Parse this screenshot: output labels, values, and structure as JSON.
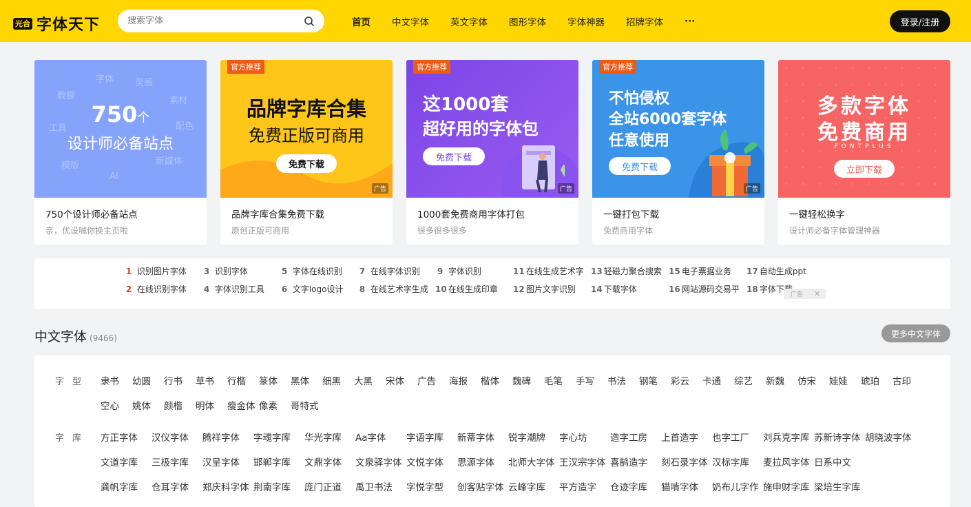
{
  "header": {
    "logo_badge": "光合",
    "logo_text": "字体天下",
    "search_placeholder": "搜索字体",
    "login": "登录/注册",
    "nav": [
      "首页",
      "中文字体",
      "英文字体",
      "图形字体",
      "字体神器",
      "招牌字体",
      "···"
    ]
  },
  "cards": [
    {
      "tag": "",
      "title": "750个设计师必备站点",
      "sub": "亲，优设喊你换主页啦",
      "banner": {
        "big": "750",
        "unit": "个",
        "mid": "设计师必备站点",
        "words": [
          "字体",
          "灵感",
          "教程",
          "素材",
          "工具",
          "配色",
          "模版",
          "新媒体",
          "AI"
        ]
      }
    },
    {
      "tag": "官方推荐",
      "title": "品牌字库合集免费下载",
      "sub": "原创正版可商用",
      "banner": {
        "t1": "品牌字库合集",
        "t2": "免费正版可商用",
        "btn": "免费下载",
        "ad": "广告"
      }
    },
    {
      "tag": "官方推荐",
      "title": "1000套免费商用字体打包",
      "sub": "很多很多很多",
      "banner": {
        "t1": "这1000套",
        "t2": "超好用的字体包",
        "btn": "免费下载",
        "ad": "广告"
      }
    },
    {
      "tag": "官方推荐",
      "title": "一键打包下载",
      "sub": "免费商用字体",
      "banner": {
        "t1": "不怕侵权",
        "t2": "全站6000套字体",
        "t3": "任意使用",
        "btn": "免费下载",
        "ad": "广告"
      }
    },
    {
      "tag": "",
      "title": "一键轻松换字",
      "sub": "设计师必备字体管理神器",
      "banner": {
        "t1": "多款字体",
        "t2": "免费商用",
        "fp": "FONTPLUS",
        "btn": "立即下载"
      }
    }
  ],
  "hot": [
    {
      "n": "1",
      "t": "识别图片字体"
    },
    {
      "n": "3",
      "t": "识别字体"
    },
    {
      "n": "5",
      "t": "字体在线识别"
    },
    {
      "n": "7",
      "t": "在线字体识别"
    },
    {
      "n": "9",
      "t": "字体识别"
    },
    {
      "n": "11",
      "t": "在线生成艺术字"
    },
    {
      "n": "13",
      "t": "轻磁力聚合搜索"
    },
    {
      "n": "15",
      "t": "电子票据业务"
    },
    {
      "n": "17",
      "t": "自动生成ppt"
    },
    {
      "n": "2",
      "t": "在线识别字体"
    },
    {
      "n": "4",
      "t": "字体识别工具"
    },
    {
      "n": "6",
      "t": "文字logo设计"
    },
    {
      "n": "8",
      "t": "在线艺术字生成"
    },
    {
      "n": "10",
      "t": "在线生成印章"
    },
    {
      "n": "12",
      "t": "图片文字识别"
    },
    {
      "n": "14",
      "t": "下载字体"
    },
    {
      "n": "16",
      "t": "网站源码交易平"
    },
    {
      "n": "18",
      "t": "字体下载"
    }
  ],
  "hot_ad": "广告",
  "section": {
    "title": "中文字体",
    "count": "(9466)",
    "more": "更多中文字体"
  },
  "filters": {
    "type_label": "字型",
    "type_row1": [
      "隶书",
      "幼圆",
      "行书",
      "草书",
      "行楷",
      "篆体",
      "黑体",
      "细黑",
      "大黑",
      "宋体",
      "广告",
      "海报",
      "楷体",
      "魏碑",
      "毛笔",
      "手写",
      "书法",
      "钢笔",
      "彩云",
      "卡通",
      "综艺",
      "新魏",
      "仿宋",
      "娃娃",
      "琥珀",
      "古印"
    ],
    "type_row2": [
      "空心",
      "姚体",
      "颜楷",
      "明体",
      "瘦金体",
      "像素",
      "哥特式"
    ],
    "lib_label": "字库",
    "lib_row1": [
      "方正字体",
      "汉仪字体",
      "腾祥字体",
      "字魂字库",
      "华光字库",
      "Aa字体",
      "字语字库",
      "新蒂字体",
      "锐字潮牌",
      "字心坊",
      "造字工房",
      "上首造字",
      "也字工厂",
      "刘兵克字库",
      "苏新诗字体",
      "胡晓波字体"
    ],
    "lib_row2": [
      "文道字库",
      "三极字库",
      "汉呈字体",
      "邯郸字库",
      "文鼎字体",
      "文泉驿字体",
      "文悦字体",
      "思源字体",
      "北师大字体",
      "王汉宗字体",
      "喜鹊造字",
      "刻石录字体",
      "汉标字库",
      "麦拉风字体",
      "日系中文"
    ],
    "lib_row3": [
      "龚帆字库",
      "仓耳字体",
      "郑庆科字体",
      "荆南字库",
      "庞门正道",
      "禹卫书法",
      "字悦字型",
      "创客贴字体",
      "云峰字库",
      "平方造字",
      "仓迹字库",
      "猫啃字体",
      "奶布儿字作",
      "施申财字库",
      "梁培生字库"
    ]
  }
}
